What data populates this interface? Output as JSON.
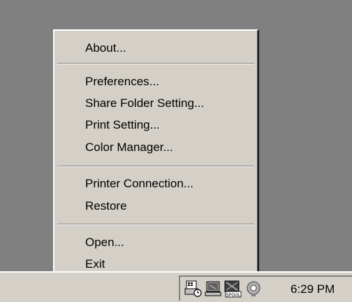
{
  "menu": {
    "items": [
      {
        "label": "About..."
      },
      {
        "label": "Preferences..."
      },
      {
        "label": "Share Folder Setting..."
      },
      {
        "label": "Print Setting..."
      },
      {
        "label": "Color Manager..."
      },
      {
        "label": "Printer Connection..."
      },
      {
        "label": "Restore"
      },
      {
        "label": "Open..."
      },
      {
        "label": "Exit"
      }
    ]
  },
  "taskbar": {
    "clock": "6:29 PM",
    "tray_icons": [
      "printer-status-icon",
      "network-computer-icon",
      "spool-icon",
      "speaker-icon"
    ],
    "spool_label": "SPOOL"
  },
  "colors": {
    "desktop": "#808080",
    "face": "#d4d0c8",
    "highlight": "#ffffff",
    "shadow": "#808080"
  }
}
